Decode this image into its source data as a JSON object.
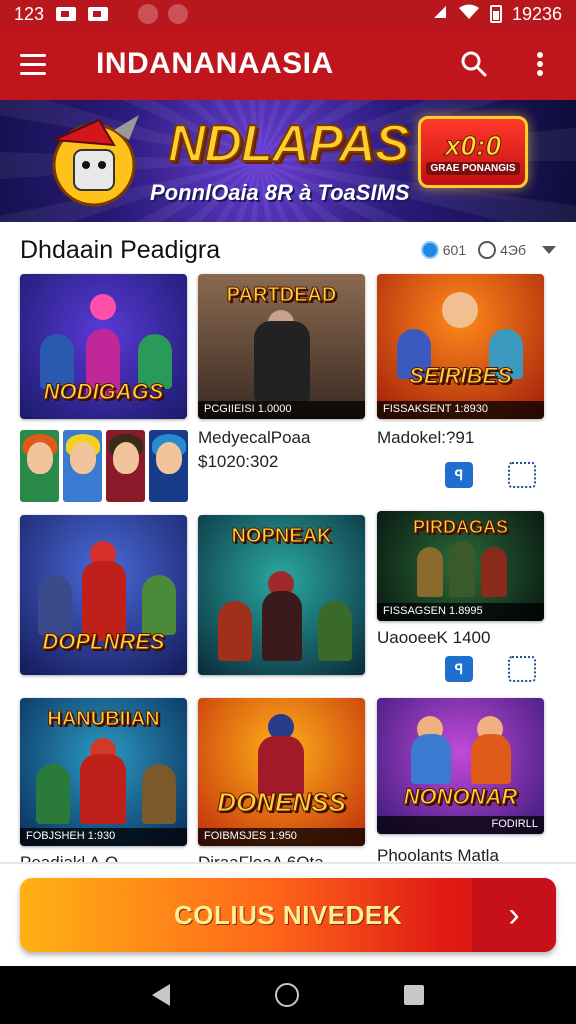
{
  "status": {
    "left_time": "123",
    "right_time": "19236"
  },
  "app_bar": {
    "title": "INDANANAASIA"
  },
  "banner": {
    "title": "NDLAPAS",
    "subtitle": "PonnlOaia 8R à ToaSIMS",
    "badge_amount": "x0:0",
    "badge_label": "GRAE PONANGIS"
  },
  "section": {
    "title": "Dhdaain Peadigra",
    "tool_1": "601",
    "tool_2": "4Эб"
  },
  "tiles": [
    {
      "label": "NODIGAGS",
      "footer": ""
    },
    {
      "label": "PARTDEAD",
      "footer": "PCGIIEISI  1.0000"
    },
    {
      "label": "SEIRIBES",
      "footer": "FISSAKSENT  1:8930"
    },
    {
      "label": "DOPLNRES",
      "footer": ""
    },
    {
      "label": "NOPNEAK",
      "footer": ""
    },
    {
      "label": "PIRDAGAS",
      "footer": "FISSAGSEN  1.8995"
    },
    {
      "label": "HANUBIIAN",
      "footer": "FOBJSHEH  1:930"
    },
    {
      "label": "DONENSS",
      "footer": "FOIBMSJES  1:950"
    },
    {
      "label": "NONONAR",
      "footer": "FODIRLL"
    }
  ],
  "captions": {
    "c1_line1": "MedyecalPoaa",
    "c1_line2": "$1020:302",
    "c2": "Madokel:?91",
    "c3": "UaooeeK 1400",
    "row3_a": "Peadiakl A.Q",
    "row3_b": "DiraaFloaA 6Qta",
    "row3_c": "Phoolants Matla"
  },
  "mini_buttons": {
    "solid_label": "ꟼ"
  },
  "cta": {
    "label": "COLIUS NIVEDEK",
    "arrow": "›"
  },
  "colors": {
    "brand_red": "#c0151c",
    "cta_orange": "#ff6a1a",
    "accent_blue": "#1e6fd0"
  }
}
